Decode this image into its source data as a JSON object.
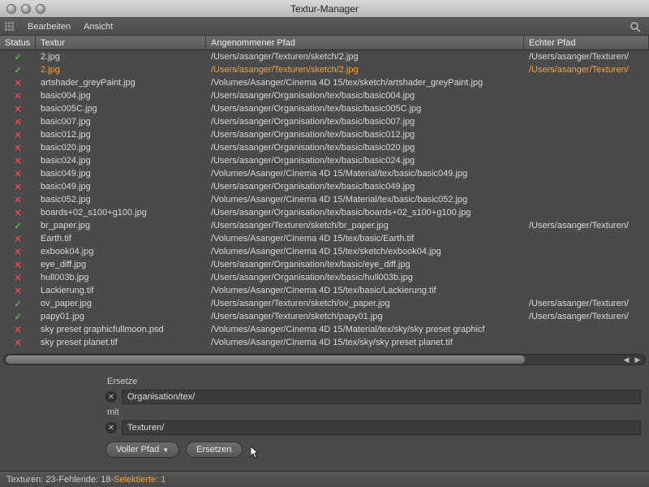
{
  "window": {
    "title": "Textur-Manager"
  },
  "menubar": {
    "edit": "Bearbeiten",
    "view": "Ansicht"
  },
  "columns": {
    "status": "Status",
    "texture": "Textur",
    "assumed_path": "Angenommener Pfad",
    "real_path": "Echter Pfad"
  },
  "rows": [
    {
      "ok": true,
      "sel": false,
      "tex": "2.jpg",
      "assume": "/Users/asanger/Texturen/sketch/2.jpg",
      "real": "/Users/asanger/Texturen/"
    },
    {
      "ok": true,
      "sel": true,
      "tex": "2.jpg",
      "assume": "/Users/asanger/Texturen/sketch/2.jpg",
      "real": "/Users/asanger/Texturen/"
    },
    {
      "ok": false,
      "sel": false,
      "tex": "artshader_greyPaint.jpg",
      "assume": "/Volumes/Asanger/Cinema 4D 15/tex/sketch/artshader_greyPaint.jpg",
      "real": ""
    },
    {
      "ok": false,
      "sel": false,
      "tex": "basic004.jpg",
      "assume": "/Users/asanger/Organisation/tex/basic/basic004.jpg",
      "real": ""
    },
    {
      "ok": false,
      "sel": false,
      "tex": "basic005C.jpg",
      "assume": "/Users/asanger/Organisation/tex/basic/basic005C.jpg",
      "real": ""
    },
    {
      "ok": false,
      "sel": false,
      "tex": "basic007.jpg",
      "assume": "/Users/asanger/Organisation/tex/basic/basic007.jpg",
      "real": ""
    },
    {
      "ok": false,
      "sel": false,
      "tex": "basic012.jpg",
      "assume": "/Users/asanger/Organisation/tex/basic/basic012.jpg",
      "real": ""
    },
    {
      "ok": false,
      "sel": false,
      "tex": "basic020.jpg",
      "assume": "/Users/asanger/Organisation/tex/basic/basic020.jpg",
      "real": ""
    },
    {
      "ok": false,
      "sel": false,
      "tex": "basic024.jpg",
      "assume": "/Users/asanger/Organisation/tex/basic/basic024.jpg",
      "real": ""
    },
    {
      "ok": false,
      "sel": false,
      "tex": "basic049.jpg",
      "assume": "/Volumes/Asanger/Cinema 4D 15/Material/tex/basic/basic049.jpg",
      "real": ""
    },
    {
      "ok": false,
      "sel": false,
      "tex": "basic049.jpg",
      "assume": "/Users/asanger/Organisation/tex/basic/basic049.jpg",
      "real": ""
    },
    {
      "ok": false,
      "sel": false,
      "tex": "basic052.jpg",
      "assume": "/Volumes/Asanger/Cinema 4D 15/Material/tex/basic/basic052.jpg",
      "real": ""
    },
    {
      "ok": false,
      "sel": false,
      "tex": "boards+02_s100+g100.jpg",
      "assume": "/Users/asanger/Organisation/tex/basic/boards+02_s100+g100.jpg",
      "real": ""
    },
    {
      "ok": true,
      "sel": false,
      "tex": "br_paper.jpg",
      "assume": "/Users/asanger/Texturen/sketch/br_paper.jpg",
      "real": "/Users/asanger/Texturen/"
    },
    {
      "ok": false,
      "sel": false,
      "tex": "Earth.tif",
      "assume": "/Volumes/Asanger/Cinema 4D 15/tex/basic/Earth.tif",
      "real": ""
    },
    {
      "ok": false,
      "sel": false,
      "tex": "exbook04.jpg",
      "assume": "/Volumes/Asanger/Cinema 4D 15/tex/sketch/exbook04.jpg",
      "real": ""
    },
    {
      "ok": false,
      "sel": false,
      "tex": "eye_diff.jpg",
      "assume": "/Users/asanger/Organisation/tex/basic/eye_diff.jpg",
      "real": ""
    },
    {
      "ok": false,
      "sel": false,
      "tex": "hull003b.jpg",
      "assume": "/Users/asanger/Organisation/tex/basic/hull003b.jpg",
      "real": ""
    },
    {
      "ok": false,
      "sel": false,
      "tex": "Lackierung.tif",
      "assume": "/Volumes/Asanger/Cinema 4D 15/tex/basic/Lackierung.tif",
      "real": ""
    },
    {
      "ok": true,
      "sel": false,
      "tex": "ov_paper.jpg",
      "assume": "/Users/asanger/Texturen/sketch/ov_paper.jpg",
      "real": "/Users/asanger/Texturen/"
    },
    {
      "ok": true,
      "sel": false,
      "tex": "papy01.jpg",
      "assume": "/Users/asanger/Texturen/sketch/papy01.jpg",
      "real": "/Users/asanger/Texturen/"
    },
    {
      "ok": false,
      "sel": false,
      "tex": "sky preset graphicfullmoon.psd",
      "assume": "/Volumes/Asanger/Cinema 4D 15/Material/tex/sky/sky preset graphicf",
      "real": ""
    },
    {
      "ok": false,
      "sel": false,
      "tex": "sky preset planet.tif",
      "assume": "/Volumes/Asanger/Cinema 4D 15/tex/sky/sky preset planet.tif",
      "real": ""
    }
  ],
  "form": {
    "replace_label": "Ersetze",
    "replace_value": "Organisation/tex/",
    "with_label": "mit",
    "with_value": "Texturen/",
    "mode_label": "Voller Pfad",
    "button_label": "Ersetzen"
  },
  "status": {
    "textures_label": "Texturen:",
    "textures_count": "23",
    "missing_label": "Fehlende:",
    "missing_count": "18",
    "selected_label": "Selektierte:",
    "selected_count": "1",
    "sep": " - "
  },
  "glyph": {
    "ok": "✓",
    "bad": "✕"
  }
}
